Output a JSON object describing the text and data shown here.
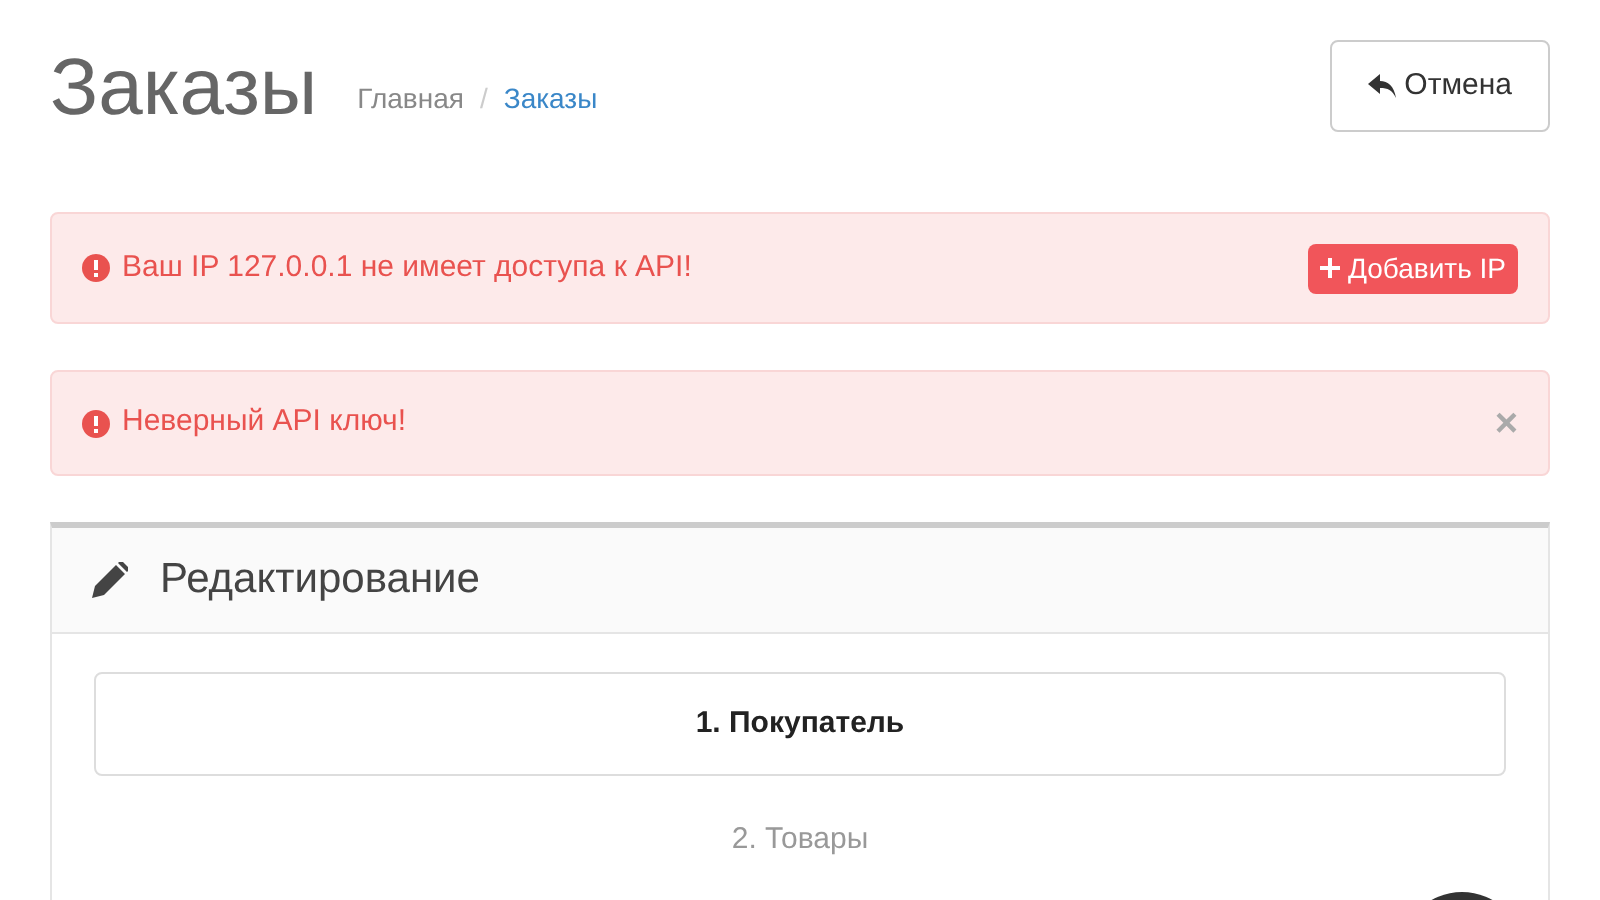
{
  "page": {
    "title": "Заказы",
    "breadcrumb_separator": "/",
    "breadcrumbs": [
      {
        "label": "Главная",
        "selected": false
      },
      {
        "label": "Заказы",
        "selected": true
      }
    ],
    "cancel_button": "Отмена"
  },
  "alerts": [
    {
      "text": "Ваш IP 127.0.0.1 не имеет доступа к API!",
      "kind": "action",
      "action": "Добавить IP"
    },
    {
      "text": "Неверный API ключ!",
      "kind": "dismissible",
      "close": "×"
    }
  ],
  "panel": {
    "title": "Редактирование",
    "steps": [
      {
        "label": "1. Покупатель",
        "selected": true
      },
      {
        "label": "2. Товары",
        "selected": false
      }
    ]
  }
}
